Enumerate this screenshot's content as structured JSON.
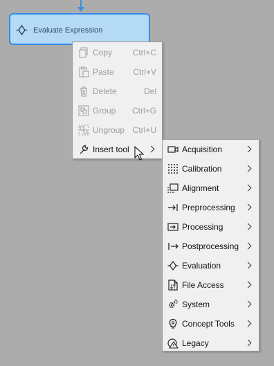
{
  "node": {
    "label": "Evaluate Expression",
    "icon": "evaluation-icon"
  },
  "context_menu": {
    "items": [
      {
        "label": "Copy",
        "shortcut": "Ctrl+C",
        "icon": "copy-icon",
        "enabled": false
      },
      {
        "label": "Paste",
        "shortcut": "Ctrl+V",
        "icon": "paste-icon",
        "enabled": false
      },
      {
        "label": "Delete",
        "shortcut": "Del",
        "icon": "trash-icon",
        "enabled": false
      },
      {
        "label": "Group",
        "shortcut": "Ctrl+G",
        "icon": "group-icon",
        "enabled": false
      },
      {
        "label": "Ungroup",
        "shortcut": "Ctrl+U",
        "icon": "ungroup-icon",
        "enabled": false
      },
      {
        "label": "Insert tool",
        "shortcut": "",
        "icon": "wrench-icon",
        "enabled": true,
        "submenu": true
      }
    ]
  },
  "submenu": {
    "items": [
      {
        "label": "Acquisition",
        "icon": "camera-icon"
      },
      {
        "label": "Calibration",
        "icon": "calibration-grid-icon"
      },
      {
        "label": "Alignment",
        "icon": "alignment-icon"
      },
      {
        "label": "Preprocessing",
        "icon": "preprocessing-icon"
      },
      {
        "label": "Processing",
        "icon": "processing-icon"
      },
      {
        "label": "Postprocessing",
        "icon": "postprocessing-icon"
      },
      {
        "label": "Evaluation",
        "icon": "evaluation-icon"
      },
      {
        "label": "File Access",
        "icon": "file-access-icon"
      },
      {
        "label": "System",
        "icon": "gears-icon"
      },
      {
        "label": "Concept Tools",
        "icon": "lightbulb-icon"
      },
      {
        "label": "Legacy",
        "icon": "legacy-warning-icon"
      }
    ]
  },
  "colors": {
    "canvas": "#acacac",
    "node_fill": "#b5daf6",
    "node_border": "#2f8de8",
    "connector": "#3d8fe0",
    "menu_bg": "#f0f0f0",
    "disabled_text": "#9c9c9c"
  }
}
